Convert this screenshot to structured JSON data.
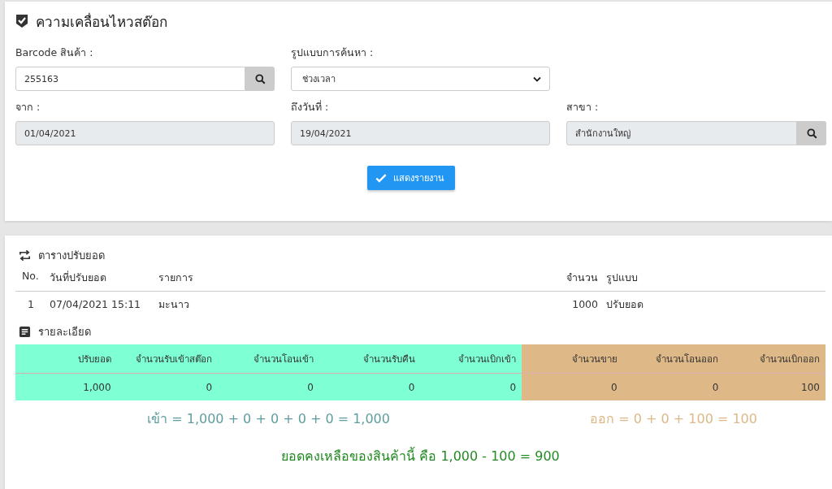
{
  "page_title": "ความเคลื่อนไหวสต๊อก",
  "form": {
    "barcode": {
      "label": "Barcode สินค้า :",
      "value": "255163",
      "disabled": false
    },
    "search_mode": {
      "label": "รูปแบบการค้นหา :",
      "value": "ช่วงเวลา"
    },
    "date_from": {
      "label": "จาก :",
      "value": "01/04/2021",
      "disabled": true
    },
    "date_to": {
      "label": "ถึงวันที่ :",
      "value": "19/04/2021",
      "disabled": true
    },
    "branch": {
      "label": "สาขา :",
      "value": "สำนักงานใหญ่",
      "disabled": true
    },
    "submit_button": "แสดงรายงาน"
  },
  "adjust_table": {
    "title": "ตารางปรับยอด",
    "columns": [
      "No.",
      "วันที่ปรับยอด",
      "รายการ",
      "จำนวน",
      "รูปแบบ"
    ],
    "rows": [
      [
        "1",
        "07/04/2021 15:11",
        "มะนาว",
        "1000",
        "ปรับยอด"
      ]
    ]
  },
  "detail": {
    "title": "รายละเอียด",
    "columns": [
      {
        "label": "ปรับยอด",
        "value": "1,000",
        "color": "#7fffd4"
      },
      {
        "label": "จำนวนรับเข้าสต๊อก",
        "value": "0",
        "color": "#7fffd4"
      },
      {
        "label": "จำนวนโอนเข้า",
        "value": "0",
        "color": "#7fffd4"
      },
      {
        "label": "จำนวนรับคืน",
        "value": "0",
        "color": "#7fffd4"
      },
      {
        "label": "จำนวนเบิกเข้า",
        "value": "0",
        "color": "#7fffd4"
      },
      {
        "label": "จำนวนขาย",
        "value": "0",
        "color": "#deb887"
      },
      {
        "label": "จำนวนโอนออก",
        "value": "0",
        "color": "#deb887"
      },
      {
        "label": "จำนวนเบิกออก",
        "value": "100",
        "color": "#deb887"
      }
    ],
    "in_formula": "เข้า = 1,000 + 0 + 0 + 0 + 0 = 1,000",
    "out_formula": "ออก = 0 + 0 + 100 = 100",
    "balance": "ยอดคงเหลือของสินค้านี้ คือ 1,000 - 100 = 900"
  }
}
